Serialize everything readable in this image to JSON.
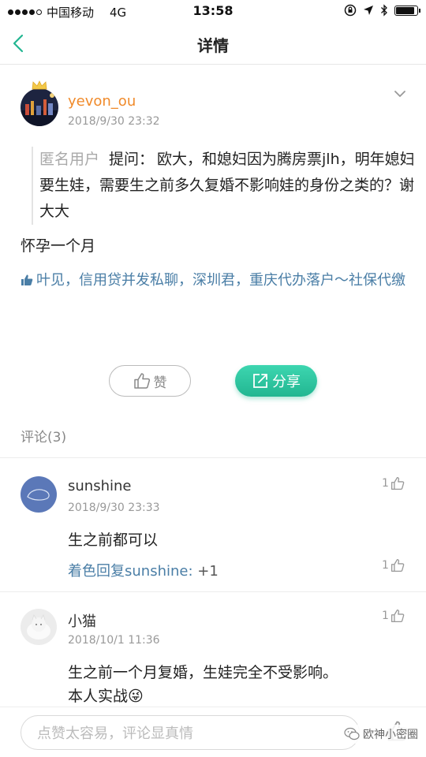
{
  "status_bar": {
    "carrier": "中国移动",
    "network": "4G",
    "time": "13:58",
    "battery_level": 0.9
  },
  "nav": {
    "title": "详情"
  },
  "post": {
    "username": "yevon_ou",
    "timestamp": "2018/9/30 23:32",
    "quote_author": "匿名用户",
    "quote_label": "提问：",
    "quote_text": "欧大，和媳妇因为腾房票jlh，明年媳妇要生娃，需要生之前多久复婚不影响娃的身份之类的？谢大大",
    "answer": "怀孕一个月",
    "likers": "叶见，信用贷并发私聊，深圳君，重庆代办落户～社保代缴",
    "like_button": "赞",
    "share_button": "分享"
  },
  "comments_header": "评论(3)",
  "comments": [
    {
      "username": "sunshine",
      "timestamp": "2018/9/30 23:33",
      "likes": "1",
      "text": "生之前都可以",
      "reply_user": "着色回复sunshine:",
      "reply_text": " +1",
      "reply_likes": "1"
    },
    {
      "username": "小猫",
      "timestamp": "2018/10/1 11:36",
      "likes": "1",
      "text_line1": "生之前一个月复婚，生娃完全不受影响。",
      "text_line2": "本人实战",
      "emoji": "😜"
    }
  ],
  "bottom_bar": {
    "input_placeholder": "点赞太容易，评论显真情",
    "watermark_text": "欧神小密圈"
  },
  "colors": {
    "accent_green": "#22b691",
    "username_orange": "#f08a2a",
    "link_blue": "#4a7ea6"
  }
}
